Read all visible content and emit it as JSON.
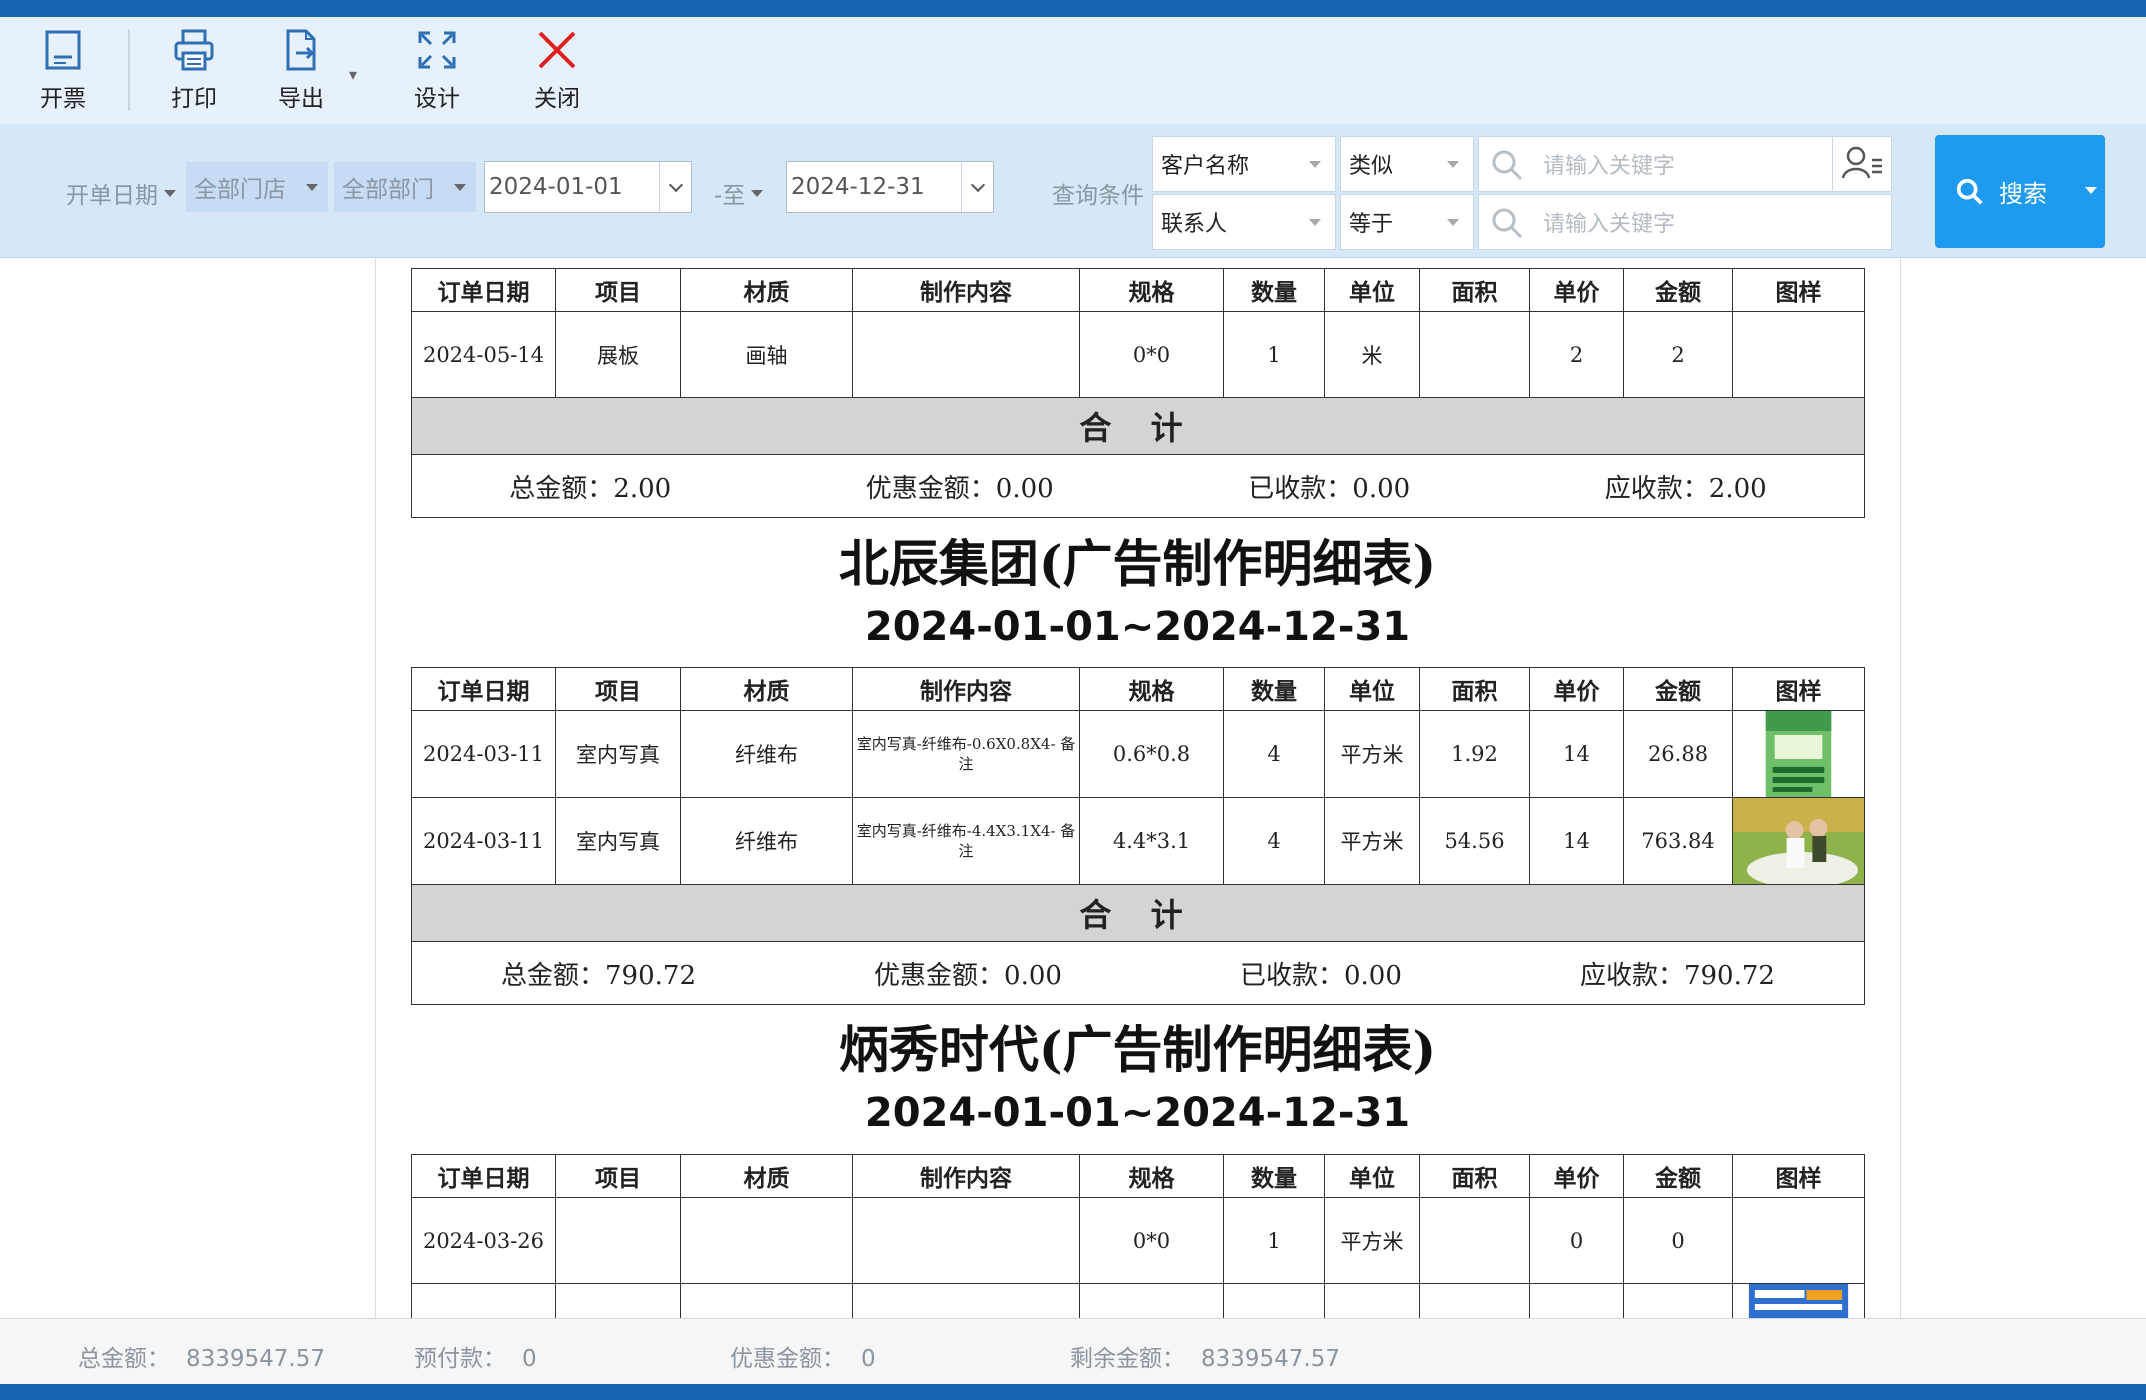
{
  "toolbar": {
    "invoice": "开票",
    "print": "打印",
    "export": "导出",
    "design": "设计",
    "close": "关闭"
  },
  "filters": {
    "date_type": "开单日期",
    "store": "全部门店",
    "dept": "全部部门",
    "date_from": "2024-01-01",
    "to_label": "-至",
    "date_to": "2024-12-31",
    "query_label": "查询条件",
    "cond1_field": "客户名称",
    "cond1_op": "类似",
    "cond1_placeholder": "请输入关键字",
    "cond2_field": "联系人",
    "cond2_op": "等于",
    "cond2_placeholder": "请输入关键字",
    "search_label": "搜索"
  },
  "columns": [
    "订单日期",
    "项目",
    "材质",
    "制作内容",
    "规格",
    "数量",
    "单位",
    "面积",
    "单价",
    "金额",
    "图样"
  ],
  "total_label": "合 计",
  "group0": {
    "rows": [
      {
        "date": "2024-05-14",
        "item": "展板",
        "material": "画轴",
        "content": "",
        "spec": "0*0",
        "qty": "1",
        "unit": "米",
        "area": "",
        "price": "2",
        "amount": "2"
      }
    ],
    "summary": {
      "total": "总金额：2.00",
      "discount": "优惠金额：0.00",
      "received": "已收款：0.00",
      "receivable": "应收款：2.00"
    }
  },
  "group1": {
    "title": "北辰集团(广告制作明细表)",
    "range": "2024-01-01~2024-12-31",
    "rows": [
      {
        "date": "2024-03-11",
        "item": "室内写真",
        "material": "纤维布",
        "content": "室内写真-纤维布-0.6X0.8X4- 备注",
        "spec": "0.6*0.8",
        "qty": "4",
        "unit": "平方米",
        "area": "1.92",
        "price": "14",
        "amount": "26.88"
      },
      {
        "date": "2024-03-11",
        "item": "室内写真",
        "material": "纤维布",
        "content": "室内写真-纤维布-4.4X3.1X4- 备注",
        "spec": "4.4*3.1",
        "qty": "4",
        "unit": "平方米",
        "area": "54.56",
        "price": "14",
        "amount": "763.84"
      }
    ],
    "summary": {
      "total": "总金额：790.72",
      "discount": "优惠金额：0.00",
      "received": "已收款：0.00",
      "receivable": "应收款：790.72"
    }
  },
  "group2": {
    "title": "炳秀时代(广告制作明细表)",
    "range": "2024-01-01~2024-12-31",
    "rows": [
      {
        "date": "2024-03-26",
        "item": "",
        "material": "",
        "content": "",
        "spec": "0*0",
        "qty": "1",
        "unit": "平方米",
        "area": "",
        "price": "0",
        "amount": "0"
      }
    ]
  },
  "status": {
    "total_label": "总金额：",
    "total_value": "8339547.57",
    "prepaid_label": "预付款：",
    "prepaid_value": "0",
    "discount_label": "优惠金额：",
    "discount_value": "0",
    "remaining_label": "剩余金额：",
    "remaining_value": "8339547.57"
  },
  "colors": {
    "titlebar": "#1565b0",
    "toolbar_bg": "#e6f1fc",
    "filter_bg": "#d6e7f8",
    "search_button": "#1e9aef",
    "close_icon": "#e02020",
    "total_row_bg": "#d4d4d4"
  },
  "icons": [
    "invoice-icon",
    "printer-icon",
    "export-icon",
    "design-icon",
    "close-icon",
    "search-icon",
    "user-list-icon"
  ]
}
